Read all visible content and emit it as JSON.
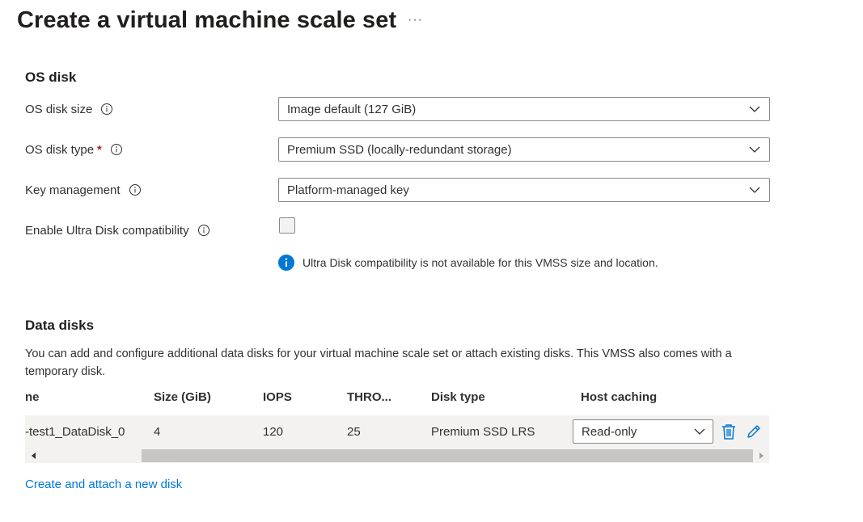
{
  "page": {
    "title": "Create a virtual machine scale set",
    "more_label": "···"
  },
  "os_disk": {
    "section_title": "OS disk",
    "size_label": "OS disk size",
    "size_value": "Image default (127 GiB)",
    "type_label": "OS disk type",
    "required_mark": "*",
    "type_value": "Premium SSD (locally-redundant storage)",
    "key_label": "Key management",
    "key_value": "Platform-managed key",
    "ultra_label": "Enable Ultra Disk compatibility",
    "ultra_checked": false,
    "ultra_info": "Ultra Disk compatibility is not available for this VMSS size and location."
  },
  "data_disks": {
    "section_title": "Data disks",
    "description": "You can add and configure additional data disks for your virtual machine scale set or attach existing disks. This VMSS also comes with a temporary disk.",
    "columns": [
      "ne",
      "Size (GiB)",
      "IOPS",
      "THRO...",
      "Disk type",
      "Host caching"
    ],
    "rows": [
      {
        "name": "-test1_DataDisk_0",
        "size": "4",
        "iops": "120",
        "throughput": "25",
        "disk_type": "Premium SSD LRS",
        "host_caching": "Read-only"
      }
    ],
    "create_link": "Create and attach a new disk"
  },
  "colors": {
    "accent": "#0078d4",
    "required": "#a4262c",
    "row_bg": "#f3f2f1"
  },
  "icons": {
    "info": "info-circle-icon",
    "chevron": "chevron-down-icon",
    "delete": "trash-icon",
    "edit": "pencil-icon",
    "scroll_left": "triangle-left-icon",
    "scroll_right": "triangle-right-icon"
  }
}
